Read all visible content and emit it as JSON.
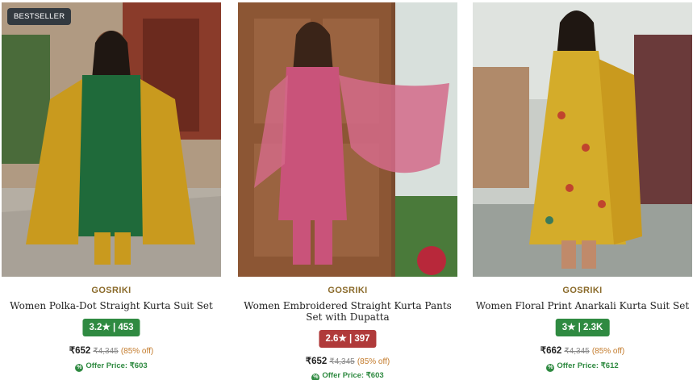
{
  "products": [
    {
      "badge": "BESTSELLER",
      "brand": "GOSRIKI",
      "title": "Women Polka-Dot Straight Kurta Suit Set",
      "rating": "3.2★ | 453",
      "rating_color": "#2f8a41",
      "price": "₹652",
      "mrp": "₹4,345",
      "discount": "(85% off)",
      "offer": "Offer Price: ₹603",
      "offer_icon": "percent-icon"
    },
    {
      "brand": "GOSRIKI",
      "title": "Women Embroidered Straight Kurta Pants Set with Dupatta",
      "rating": "2.6★ | 397",
      "rating_color": "#b03a3a",
      "price": "₹652",
      "mrp": "₹4,345",
      "discount": "(85% off)",
      "offer": "Offer Price: ₹603",
      "offer_icon": "percent-icon"
    },
    {
      "brand": "GOSRIKI",
      "title": "Women Floral Print Anarkali Kurta Suit Set",
      "rating": "3★ | 2.3K",
      "rating_color": "#2f8a41",
      "price": "₹662",
      "mrp": "₹4,345",
      "discount": "(85% off)",
      "offer": "Offer Price: ₹612",
      "offer_icon": "percent-icon"
    }
  ]
}
